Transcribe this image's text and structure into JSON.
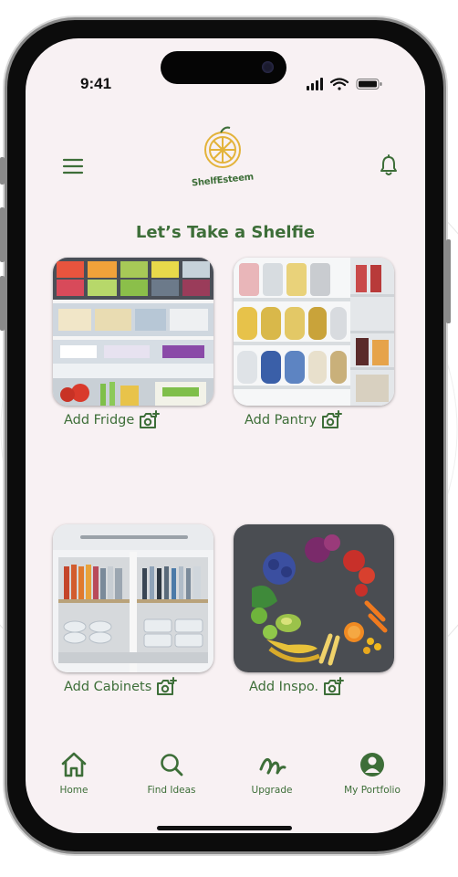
{
  "status_bar": {
    "time": "9:41"
  },
  "header": {
    "menu_icon": "hamburger-menu-icon",
    "logo_text": "ShelfEsteem",
    "bell_icon": "bell-icon"
  },
  "section_title": "Let’s Take a Shelfie",
  "cards": [
    {
      "label": "Add Fridge",
      "icon": "add-photo-camera-icon"
    },
    {
      "label": "Add Pantry",
      "icon": "add-photo-camera-icon"
    },
    {
      "label": "Add Cabinets",
      "icon": "add-photo-camera-icon"
    },
    {
      "label": "Add Inspo.",
      "icon": "add-photo-camera-icon"
    }
  ],
  "tabs": [
    {
      "label": "Home",
      "icon": "home-icon"
    },
    {
      "label": "Find Ideas",
      "icon": "search-icon"
    },
    {
      "label": "Upgrade",
      "icon": "scribble-icon"
    },
    {
      "label": "My Portfolio",
      "icon": "user-circle-icon"
    }
  ],
  "colors": {
    "accent_green": "#3d6e38",
    "logo_yellow": "#e3b33a",
    "screen_bg": "#f8f1f3"
  }
}
